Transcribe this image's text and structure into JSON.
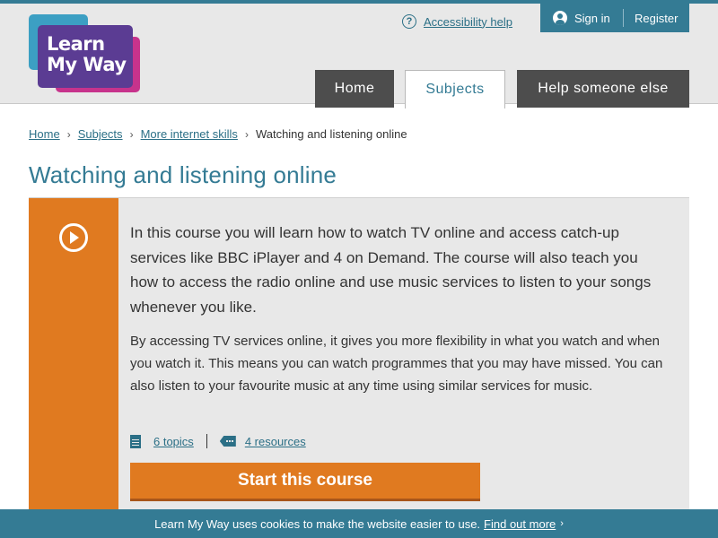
{
  "header": {
    "logo_text_line1": "Learn",
    "logo_text_line2": "My Way",
    "accessibility_label": "Accessibility help",
    "sign_in_label": "Sign in",
    "register_label": "Register"
  },
  "nav": {
    "items": [
      {
        "label": "Home",
        "active": false
      },
      {
        "label": "Subjects",
        "active": true
      },
      {
        "label": "Help someone else",
        "active": false
      }
    ]
  },
  "breadcrumb": {
    "items": [
      "Home",
      "Subjects",
      "More internet skills"
    ],
    "current": "Watching and listening online"
  },
  "page": {
    "title": "Watching and listening online"
  },
  "course": {
    "icon": "play-icon",
    "intro": "In this course you will learn how to watch TV online and access catch-up services like BBC iPlayer and 4 on Demand. The course will also teach you how to access the radio online and use music services to listen to your songs whenever you like.",
    "description": "By accessing TV services online, it gives you more flexibility in what you watch and when you watch it. This means you can watch programmes that you may have missed. You can also listen to your favourite music at any time using similar services for music.",
    "topics_label": "6 topics",
    "resources_label": "4 resources",
    "start_label": "Start this course"
  },
  "cookie": {
    "message": "Learn My Way uses cookies to make the website easier to use.",
    "link_label": "Find out more",
    "chevron": "›"
  },
  "colors": {
    "brand_teal": "#347b94",
    "accent_orange": "#e07a20",
    "nav_dark": "#4d4d4d",
    "panel_grey": "#e8e8e8"
  }
}
